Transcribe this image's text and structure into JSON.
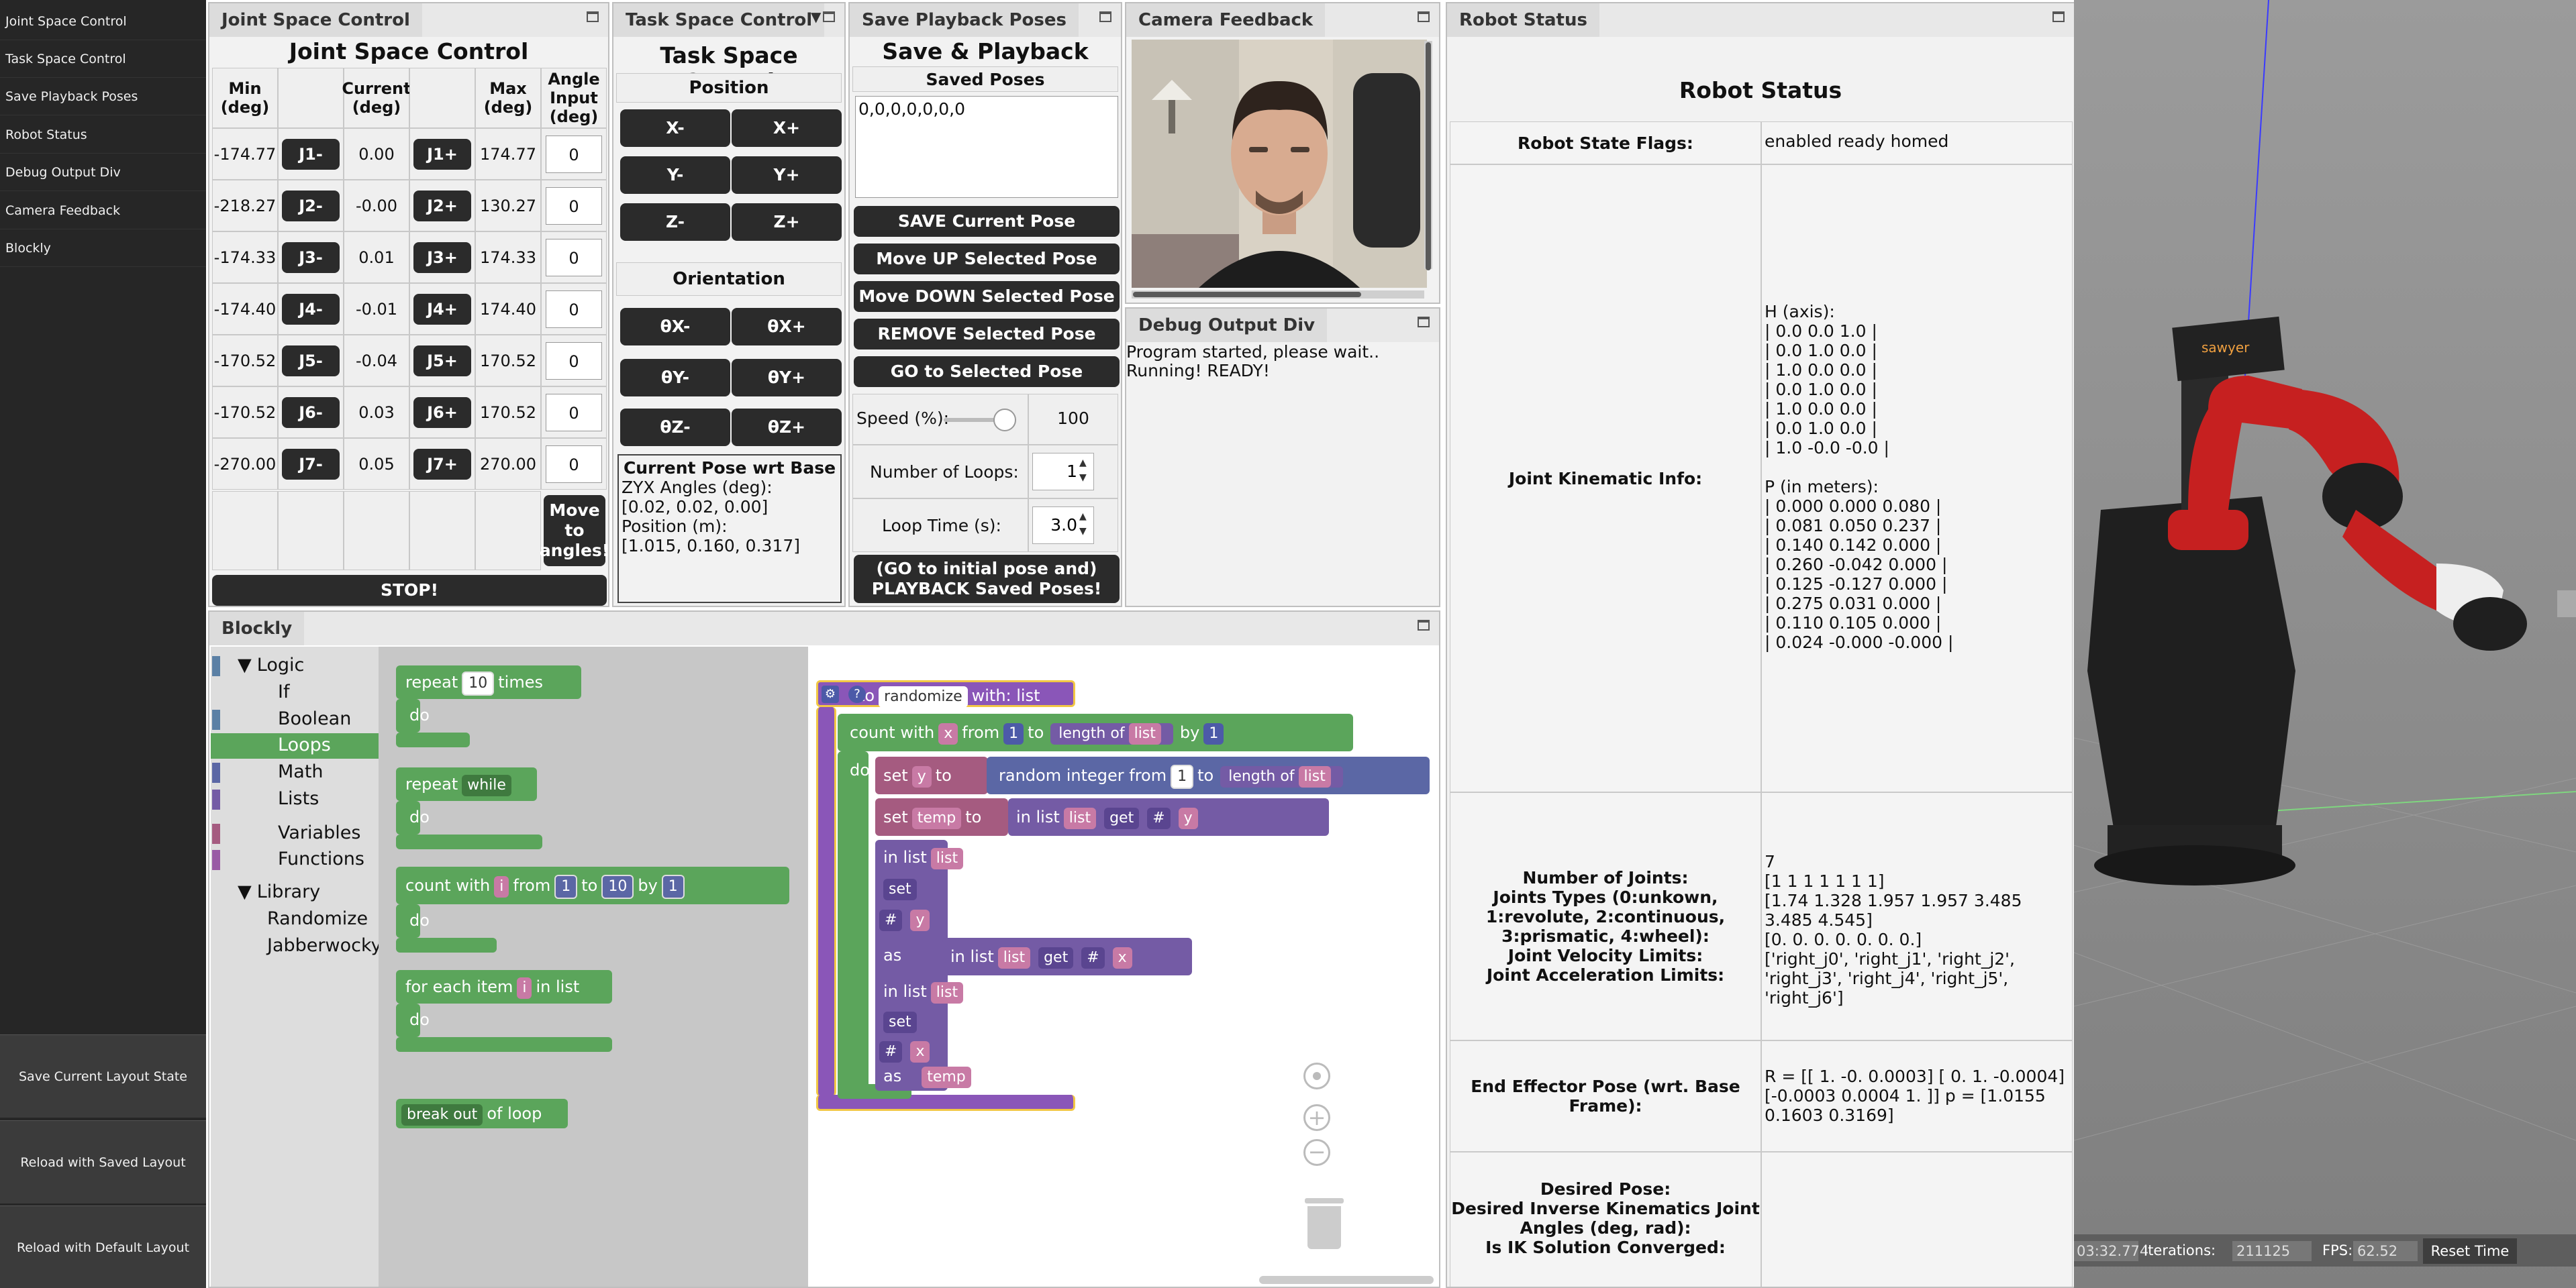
{
  "sidebar": {
    "items": [
      "Joint Space Control",
      "Task Space Control",
      "Save Playback Poses",
      "Robot Status",
      "Debug Output Div",
      "Camera Feedback",
      "Blockly"
    ],
    "buttons": [
      "Save Current Layout State",
      "Reload with Saved Layout",
      "Reload with Default Layout"
    ]
  },
  "joint_panel": {
    "tab": "Joint Space Control",
    "title": "Joint Space Control",
    "headers": {
      "min": "Min (deg)",
      "current": "Current (deg)",
      "max": "Max (deg)",
      "angle_input": "Angle Input (deg)"
    },
    "rows": [
      {
        "min": "-174.77",
        "minus": "J1-",
        "current": "0.00",
        "plus": "J1+",
        "max": "174.77",
        "input": "0"
      },
      {
        "min": "-218.27",
        "minus": "J2-",
        "current": "-0.00",
        "plus": "J2+",
        "max": "130.27",
        "input": "0"
      },
      {
        "min": "-174.33",
        "minus": "J3-",
        "current": "0.01",
        "plus": "J3+",
        "max": "174.33",
        "input": "0"
      },
      {
        "min": "-174.40",
        "minus": "J4-",
        "current": "-0.01",
        "plus": "J4+",
        "max": "174.40",
        "input": "0"
      },
      {
        "min": "-170.52",
        "minus": "J5-",
        "current": "-0.04",
        "plus": "J5+",
        "max": "170.52",
        "input": "0"
      },
      {
        "min": "-170.52",
        "minus": "J6-",
        "current": "0.03",
        "plus": "J6+",
        "max": "170.52",
        "input": "0"
      },
      {
        "min": "-270.00",
        "minus": "J7-",
        "current": "0.05",
        "plus": "J7+",
        "max": "270.00",
        "input": "0"
      }
    ],
    "move_button": "Move to angles!",
    "stop_button": "STOP!"
  },
  "task_panel": {
    "tab": "Task Space Control",
    "title": "Task Space Control",
    "position_label": "Position",
    "position_buttons": [
      [
        "X-",
        "X+"
      ],
      [
        "Y-",
        "Y+"
      ],
      [
        "Z-",
        "Z+"
      ]
    ],
    "orientation_label": "Orientation",
    "orientation_buttons": [
      [
        "θX-",
        "θX+"
      ],
      [
        "θY-",
        "θY+"
      ],
      [
        "θZ-",
        "θZ+"
      ]
    ],
    "pose_title": "Current Pose wrt Base",
    "zyx_label": "ZYX Angles (deg):",
    "zyx_value": "[0.02, 0.02, 0.00]",
    "pos_label": "Position (m):",
    "pos_value": "[1.015, 0.160, 0.317]"
  },
  "playback_panel": {
    "tab": "Save Playback Poses",
    "title": "Save & Playback Poses",
    "saved_label": "Saved Poses",
    "saved_item": "0,0,0,0,0,0,0",
    "buttons": [
      "SAVE Current Pose",
      "Move UP Selected Pose",
      "Move DOWN Selected Pose",
      "REMOVE Selected Pose",
      "GO to Selected Pose"
    ],
    "speed_label": "Speed (%):",
    "speed_value": "100",
    "speed_fraction": 1.0,
    "loops_label": "Number of Loops:",
    "loops_value": "1",
    "loop_time_label": "Loop Time (s):",
    "loop_time_value": "3.0",
    "playback_button": "(GO to initial pose and) PLAYBACK Saved Poses!"
  },
  "camera_panel": {
    "tab": "Camera Feedback"
  },
  "debug_panel": {
    "tab": "Debug Output Div",
    "lines": [
      "Program started, please wait..",
      "Running! READY!"
    ]
  },
  "robot_status": {
    "tab": "Robot Status",
    "title": "Robot Status",
    "flags_label": "Robot State Flags:",
    "flags_value": "enabled ready homed",
    "kin_label": "Joint Kinematic Info:",
    "kin_lines": [
      "H (axis):",
      "| 0.0 0.0 1.0 |",
      "| 0.0 1.0 0.0 |",
      "| 1.0 0.0 0.0 |",
      "| 0.0 1.0 0.0 |",
      "| 1.0 0.0 0.0 |",
      "| 0.0 1.0 0.0 |",
      "| 1.0 -0.0 -0.0 |",
      "",
      "P (in meters):",
      "| 0.000 0.000 0.080 |",
      "| 0.081 0.050 0.237 |",
      "| 0.140 0.142 0.000 |",
      "| 0.260 -0.042 0.000 |",
      "| 0.125 -0.127 0.000 |",
      "| 0.275 0.031 0.000 |",
      "| 0.110 0.105 0.000 |",
      "| 0.024 -0.000 -0.000 |"
    ],
    "joints_labels": [
      "Number of Joints:",
      "Joints Types (0:unkown, 1:revolute, 2:continuous, 3:prismatic, 4:wheel):",
      "Joint Velocity Limits:",
      "Joint Acceleration Limits:"
    ],
    "joints_lines": [
      "7",
      "[1 1 1 1 1 1 1]",
      "[1.74 1.328 1.957 1.957 3.485 3.485 4.545]",
      "[0. 0. 0. 0. 0. 0. 0.]",
      "['right_j0', 'right_j1', 'right_j2', 'right_j3', 'right_j4', 'right_j5', 'right_j6']"
    ],
    "ee_label": "End Effector Pose (wrt. Base Frame):",
    "ee_value": "R = [[ 1. -0. 0.0003] [ 0. 1. -0.0004] [-0.0003 0.0004 1. ]] p = [1.0155 0.1603 0.3169]",
    "desired_labels": [
      "Desired Pose:",
      "Desired Inverse Kinematics Joint Angles (deg, rad):",
      "Is IK Solution Converged:"
    ]
  },
  "blockly": {
    "tab": "Blockly",
    "categories": [
      {
        "label": "Logic",
        "indent": 0,
        "arrow": "▼",
        "color": "#5b80a5"
      },
      {
        "label": "If",
        "indent": 1,
        "color": ""
      },
      {
        "label": "Boolean",
        "indent": 1,
        "color": "#5b80a5"
      },
      {
        "label": "Loops",
        "indent": 1,
        "color": "#5ba55b",
        "selected": true
      },
      {
        "label": "Math",
        "indent": 1,
        "color": "#5b67a5"
      },
      {
        "label": "Lists",
        "indent": 1,
        "color": "#745ba5"
      },
      {
        "label": "Variables",
        "indent": 1,
        "color": "#a55b80"
      },
      {
        "label": "Functions",
        "indent": 1,
        "color": "#995ba5"
      },
      {
        "label": "Library",
        "indent": 0,
        "arrow": "▼",
        "color": ""
      },
      {
        "label": "Randomize",
        "indent": 2,
        "color": ""
      },
      {
        "label": "Jabberwocky",
        "indent": 2,
        "color": ""
      }
    ],
    "flyout": {
      "repeat": "repeat",
      "times": "times",
      "repeat_n": "10",
      "do": "do",
      "while": "while",
      "count_with": "count with",
      "i": "i",
      "from": "from",
      "to": "to",
      "by": "by",
      "n1": "1",
      "n10": "10",
      "for_each": "for each item",
      "in_list": "in list",
      "break": "break out",
      "of_loop": "of loop"
    },
    "func": {
      "to": "to",
      "name": "randomize",
      "with": "with: list",
      "count_with": "count with",
      "x": "x",
      "from": "from",
      "one": "1",
      "to2": "to",
      "length_of": "length of",
      "list": "list",
      "by": "by",
      "do": "do",
      "set": "set",
      "y": "y",
      "rand": "random integer from",
      "temp": "temp",
      "in_list": "in list",
      "get": "get",
      "hash": "#",
      "as": "as"
    }
  },
  "sim": {
    "sim_time": "03:32.774",
    "iterations_label": "Iterations:",
    "iterations": "211125",
    "fps_label": "FPS:",
    "fps": "62.52",
    "reset": "Reset Time",
    "logo": "sawyer"
  }
}
